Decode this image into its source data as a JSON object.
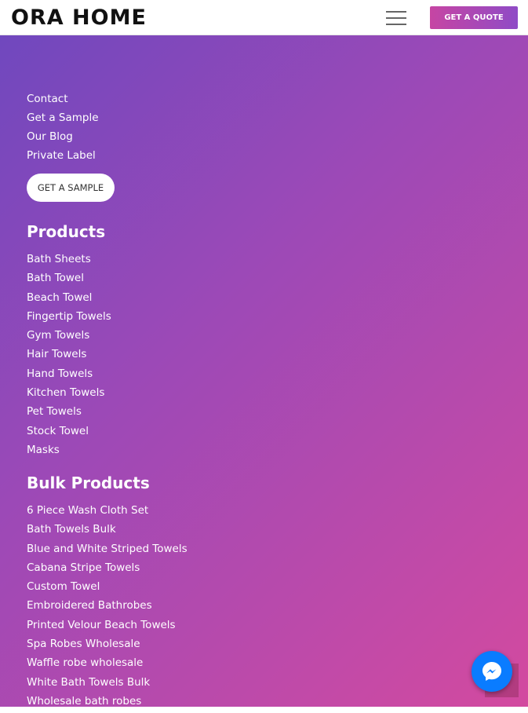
{
  "header": {
    "logo": "ORA HOME",
    "quote_label": "GET A QUOTE"
  },
  "nav": {
    "items": [
      "Contact",
      "Get a Sample",
      "Our Blog",
      "Private Label"
    ],
    "sample_button": "GET A SAMPLE"
  },
  "products": {
    "heading": "Products",
    "items": [
      "Bath Sheets",
      "Bath Towel",
      "Beach Towel",
      "Fingertip Towels",
      "Gym Towels",
      "Hair Towels",
      "Hand Towels",
      "Kitchen Towels",
      "Pet Towels",
      "Stock Towel",
      "Masks"
    ]
  },
  "bulk": {
    "heading": "Bulk Products",
    "items": [
      "6 Piece Wash Cloth Set",
      "Bath Towels Bulk",
      "Blue and White Striped Towels",
      "Cabana Stripe Towels",
      "Custom Towel",
      "Embroidered Bathrobes",
      "Printed Velour Beach Towels",
      "Spa Robes Wholesale",
      "Waffle robe wholesale",
      "White Bath Towels Bulk",
      "Wholesale bath robes"
    ]
  },
  "colors": {
    "gradient_start": "#7048be",
    "gradient_end": "#d34a9f",
    "messenger": "#0a7cff"
  }
}
